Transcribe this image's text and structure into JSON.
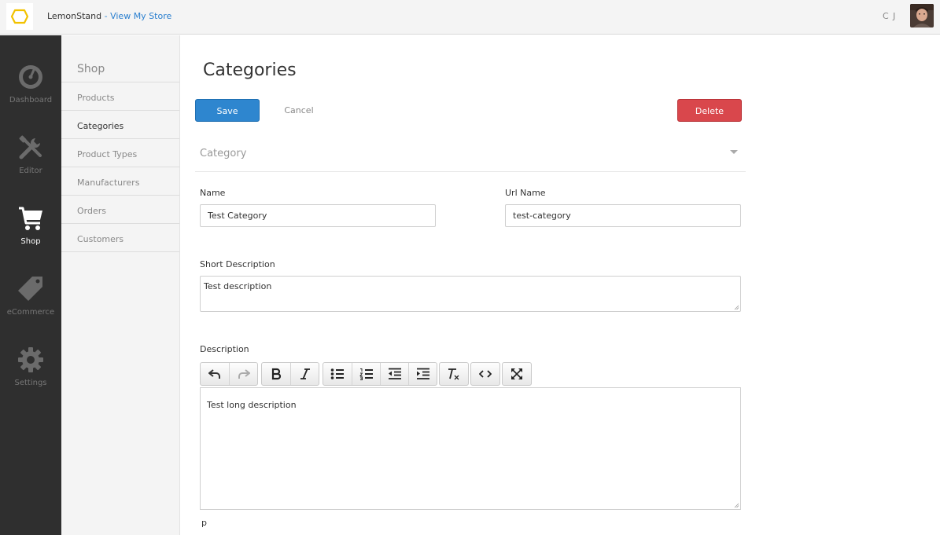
{
  "header": {
    "app_name": "LemonStand",
    "separator": " - ",
    "store_link": "View My Store",
    "user_initials": "C J"
  },
  "left_nav": {
    "items": [
      {
        "label": "Dashboard",
        "icon": "dashboard-gauge-icon"
      },
      {
        "label": "Editor",
        "icon": "tools-icon"
      },
      {
        "label": "Shop",
        "icon": "cart-icon"
      },
      {
        "label": "eCommerce",
        "icon": "tag-icon"
      },
      {
        "label": "Settings",
        "icon": "gear-icon"
      }
    ],
    "active": "Shop"
  },
  "sub_nav": {
    "title": "Shop",
    "items": [
      {
        "label": "Products"
      },
      {
        "label": "Categories"
      },
      {
        "label": "Product Types"
      },
      {
        "label": "Manufacturers"
      },
      {
        "label": "Orders"
      },
      {
        "label": "Customers"
      }
    ],
    "active": "Categories"
  },
  "main": {
    "title": "Categories",
    "save_label": "Save",
    "cancel_label": "Cancel",
    "delete_label": "Delete",
    "section_title": "Category",
    "name_label": "Name",
    "name_value": "Test Category",
    "url_label": "Url Name",
    "url_value": "test-category",
    "short_desc_label": "Short Description",
    "short_desc_value": "Test description",
    "desc_label": "Description",
    "desc_value": "Test long description",
    "element_path": "p"
  },
  "editor_toolbar": {
    "buttons": [
      "undo-icon",
      "redo-icon",
      "bold-icon",
      "italic-icon",
      "bullet-list-icon",
      "numbered-list-icon",
      "outdent-icon",
      "indent-icon",
      "clear-format-icon",
      "code-icon",
      "fullscreen-icon"
    ]
  },
  "colors": {
    "save": "#2e86cf",
    "delete": "#d9474c",
    "sidebar": "#2f2f2f",
    "logo_accent": "#f2c200"
  }
}
